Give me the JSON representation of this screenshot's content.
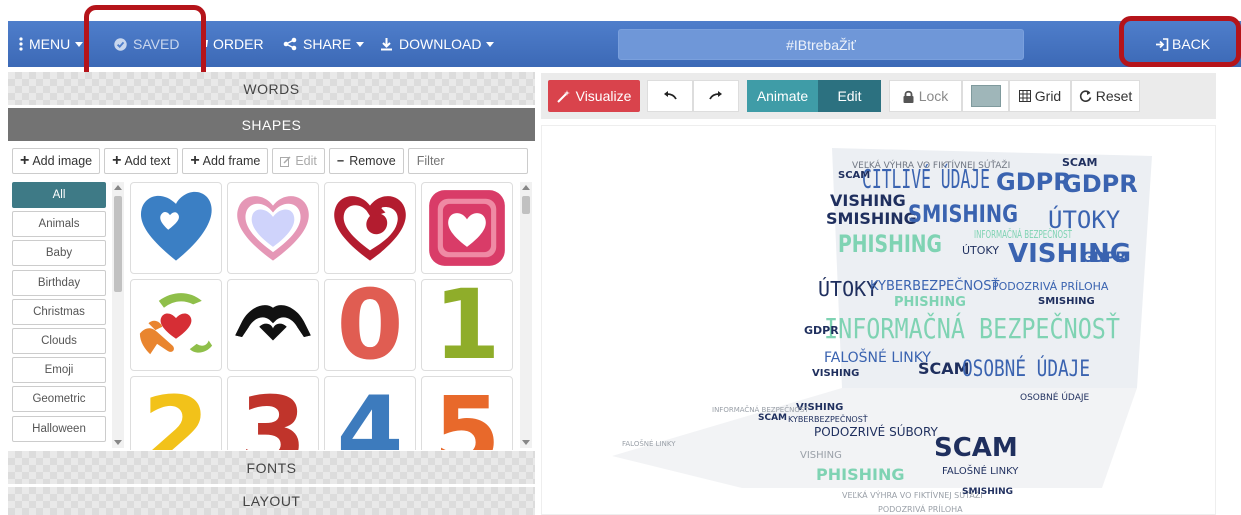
{
  "topbar": {
    "menu_label": "MENU",
    "saved_label": "SAVED",
    "order_label": "ORDER",
    "share_label": "SHARE",
    "download_label": "DOWNLOAD",
    "title": "#IBtrebaŽiť",
    "back_label": "BACK"
  },
  "left_panel": {
    "sections": {
      "words": "WORDS",
      "shapes": "SHAPES",
      "fonts": "FONTS",
      "layout": "LAYOUT"
    },
    "toolbar": {
      "add_image": "Add image",
      "add_text": "Add text",
      "add_frame": "Add frame",
      "edit": "Edit",
      "remove": "Remove",
      "filter_placeholder": "Filter"
    },
    "categories": [
      "All",
      "Animals",
      "Baby",
      "Birthday",
      "Christmas",
      "Clouds",
      "Emoji",
      "Geometric",
      "Halloween"
    ],
    "selected_category": "All",
    "shapes": [
      "heart",
      "heart-outline",
      "heart-arrow",
      "heart-square",
      "hands-heart",
      "hands-heart-silhouette",
      "number-0",
      "number-1",
      "number-2",
      "number-3",
      "number-4",
      "number-5"
    ],
    "number_glyphs": {
      "n0": "0",
      "n1": "1",
      "n2": "2",
      "n3": "3",
      "n4": "4",
      "n5": "5"
    },
    "colors": {
      "heart_blue": "#3b7fc4",
      "heart_outline": "#e597b6",
      "heart_fill_light": "#cfd3fb",
      "heart_arrow": "#b31c2f",
      "heart_square": "#d93c68",
      "number_0": "#e05d52",
      "number_1": "#8fad2a",
      "number_2": "#f2c21a",
      "number_3": "#c0342b",
      "number_4": "#3d7bbd",
      "number_5": "#e8692b"
    }
  },
  "right_panel": {
    "toolbar": {
      "visualize": "Visualize",
      "animate": "Animate",
      "edit": "Edit",
      "lock": "Lock",
      "grid": "Grid",
      "reset": "Reset"
    },
    "colors": {
      "visualize": "#d9434c",
      "animate": "#3f9ca7",
      "edit": "#2c7180",
      "swatch": "#9fb6b9"
    },
    "word_cloud": {
      "shape": "laptop",
      "words": [
        "CITLIVÉ ÚDAJE",
        "GDPR",
        "SCAM",
        "ÚTOKY",
        "VISHING",
        "SMISHING",
        "PHISHING",
        "INFORMAČNÁ BEZPEČNOSŤ",
        "KYBERBEZPEČNOSŤ",
        "PODOZRIVÁ PRÍLOHA",
        "FALOŠNÉ LINKY",
        "OSOBNÉ ÚDAJE",
        "PODOZRIVÉ SÚBORY",
        "VEĽKÁ VÝHRA VO FIKTÍVNEJ SÚŤAŽI"
      ],
      "palette": [
        "#1f2f5e",
        "#3a63b0",
        "#7fd3b3",
        "#9aa0a8"
      ]
    }
  }
}
